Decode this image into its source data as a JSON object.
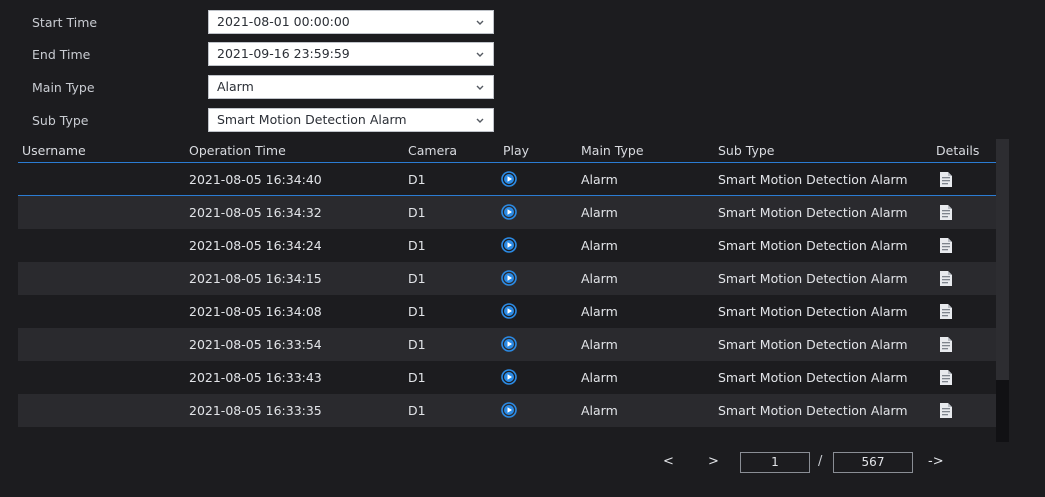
{
  "filters": {
    "start_time": {
      "label": "Start Time",
      "value": "2021-08-01 00:00:00"
    },
    "end_time": {
      "label": "End Time",
      "value": "2021-09-16 23:59:59"
    },
    "main_type": {
      "label": "Main Type",
      "value": "Alarm"
    },
    "sub_type": {
      "label": "Sub Type",
      "value": "Smart Motion Detection Alarm"
    }
  },
  "table": {
    "headers": {
      "username": "Username",
      "operation_time": "Operation Time",
      "camera": "Camera",
      "play": "Play",
      "main_type": "Main Type",
      "sub_type": "Sub Type",
      "details": "Details"
    },
    "rows": [
      {
        "username": "",
        "operation_time": "2021-08-05 16:34:40",
        "camera": "D1",
        "main_type": "Alarm",
        "sub_type": "Smart Motion Detection Alarm"
      },
      {
        "username": "",
        "operation_time": "2021-08-05 16:34:32",
        "camera": "D1",
        "main_type": "Alarm",
        "sub_type": "Smart Motion Detection Alarm"
      },
      {
        "username": "",
        "operation_time": "2021-08-05 16:34:24",
        "camera": "D1",
        "main_type": "Alarm",
        "sub_type": "Smart Motion Detection Alarm"
      },
      {
        "username": "",
        "operation_time": "2021-08-05 16:34:15",
        "camera": "D1",
        "main_type": "Alarm",
        "sub_type": "Smart Motion Detection Alarm"
      },
      {
        "username": "",
        "operation_time": "2021-08-05 16:34:08",
        "camera": "D1",
        "main_type": "Alarm",
        "sub_type": "Smart Motion Detection Alarm"
      },
      {
        "username": "",
        "operation_time": "2021-08-05 16:33:54",
        "camera": "D1",
        "main_type": "Alarm",
        "sub_type": "Smart Motion Detection Alarm"
      },
      {
        "username": "",
        "operation_time": "2021-08-05 16:33:43",
        "camera": "D1",
        "main_type": "Alarm",
        "sub_type": "Smart Motion Detection Alarm"
      },
      {
        "username": "",
        "operation_time": "2021-08-05 16:33:35",
        "camera": "D1",
        "main_type": "Alarm",
        "sub_type": "Smart Motion Detection Alarm"
      }
    ]
  },
  "pagination": {
    "prev": "<",
    "next": ">",
    "current_page": "1",
    "separator": "/",
    "total_pages": "567",
    "go": "->"
  },
  "icons": {
    "dropdown": "chevron-down-icon",
    "play": "play-circle-icon",
    "details": "document-icon"
  },
  "colors": {
    "accent": "#2b7cd3",
    "background": "#1c1c1f",
    "row_alt": "#2a2a2e"
  }
}
